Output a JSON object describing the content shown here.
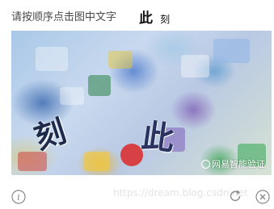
{
  "prompt": {
    "instruction": "请按顺序点击图中文字",
    "target_chars": [
      "此",
      "刻"
    ]
  },
  "captcha": {
    "glyphs": [
      "刻",
      "此"
    ],
    "watermark": "网易智能验证"
  },
  "footer": {
    "info_icon": "info-icon",
    "refresh_icon": "refresh-icon",
    "close_icon": "close-icon",
    "overlay_text": "https://dream.blog.csdn.net"
  }
}
